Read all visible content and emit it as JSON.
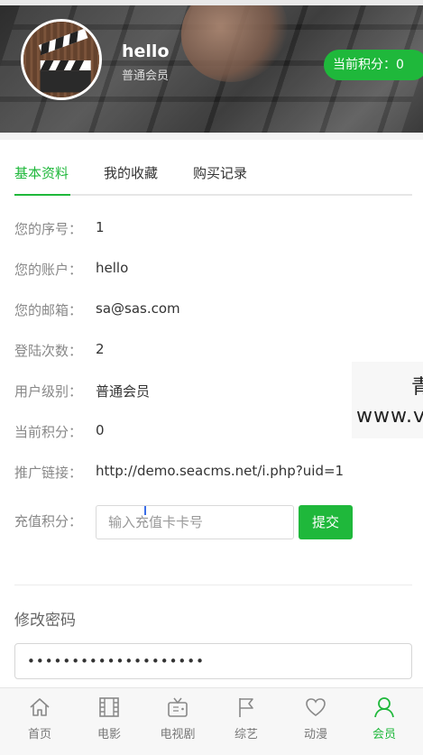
{
  "header": {
    "username": "hello",
    "user_group": "普通会员",
    "points_badge": "当前积分：0"
  },
  "tabs": [
    {
      "label": "基本资料",
      "active": true
    },
    {
      "label": "我的收藏",
      "active": false
    },
    {
      "label": "购买记录",
      "active": false
    }
  ],
  "profile": {
    "rows": [
      {
        "label": "您的序号：",
        "value": "1"
      },
      {
        "label": "您的账户：",
        "value": "hello"
      },
      {
        "label": "您的邮箱：",
        "value": "sa@sas.com"
      },
      {
        "label": "登陆次数：",
        "value": "2"
      },
      {
        "label": "用户级别：",
        "value": "普通会员"
      },
      {
        "label": "当前积分：",
        "value": "0"
      },
      {
        "label": "推广链接：",
        "value": "http://demo.seacms.net/i.php?uid=1"
      }
    ],
    "recharge_label": "充值积分：",
    "recharge_placeholder": "输入充值卡卡号",
    "submit_label": "提交"
  },
  "password": {
    "section_title": "修改密码",
    "masked_value": "••••••••••••••••••••"
  },
  "overlay": {
    "line1": "青",
    "line2": "www.v"
  },
  "bottom_nav": [
    {
      "label": "首页",
      "icon": "home-icon",
      "active": false
    },
    {
      "label": "电影",
      "icon": "film-icon",
      "active": false
    },
    {
      "label": "电视剧",
      "icon": "tv-icon",
      "active": false
    },
    {
      "label": "综艺",
      "icon": "flag-icon",
      "active": false
    },
    {
      "label": "动漫",
      "icon": "heart-icon",
      "active": false
    },
    {
      "label": "会员",
      "icon": "user-icon",
      "active": true
    }
  ],
  "colors": {
    "accent": "#1fb83b",
    "label_gray": "#888888",
    "nav_bg": "#f7f7f7"
  }
}
